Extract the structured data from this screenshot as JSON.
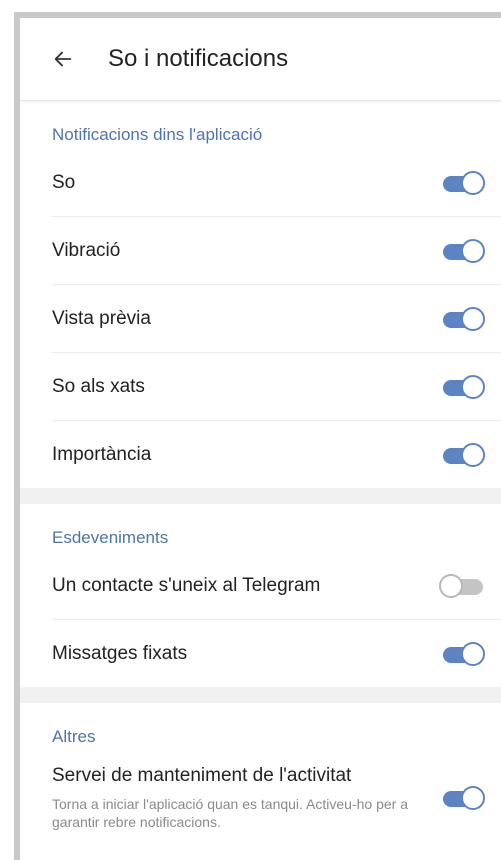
{
  "header": {
    "back_icon": "arrow-left-icon",
    "title": "So i notificacions"
  },
  "sections": [
    {
      "title": "Notificacions dins l'aplicació",
      "rows": [
        {
          "label": "So",
          "on": true
        },
        {
          "label": "Vibració",
          "on": true
        },
        {
          "label": "Vista prèvia",
          "on": true
        },
        {
          "label": "So als xats",
          "on": true
        },
        {
          "label": "Importància",
          "on": true
        }
      ]
    },
    {
      "title": "Esdeveniments",
      "rows": [
        {
          "label": "Un contacte s'uneix al Telegram",
          "on": false
        },
        {
          "label": "Missatges fixats",
          "on": true
        }
      ]
    },
    {
      "title": "Altres",
      "rows": [
        {
          "label": "Servei de manteniment de l'activitat",
          "sublabel": "Torna a iniciar l'aplicació quan es tanqui. Activeu-ho per a garantir rebre notificacions.",
          "on": true
        }
      ]
    }
  ],
  "colors": {
    "accent": "#5c83c4",
    "section_title": "#4e75a6",
    "toggle_off": "#c4c4c4"
  }
}
